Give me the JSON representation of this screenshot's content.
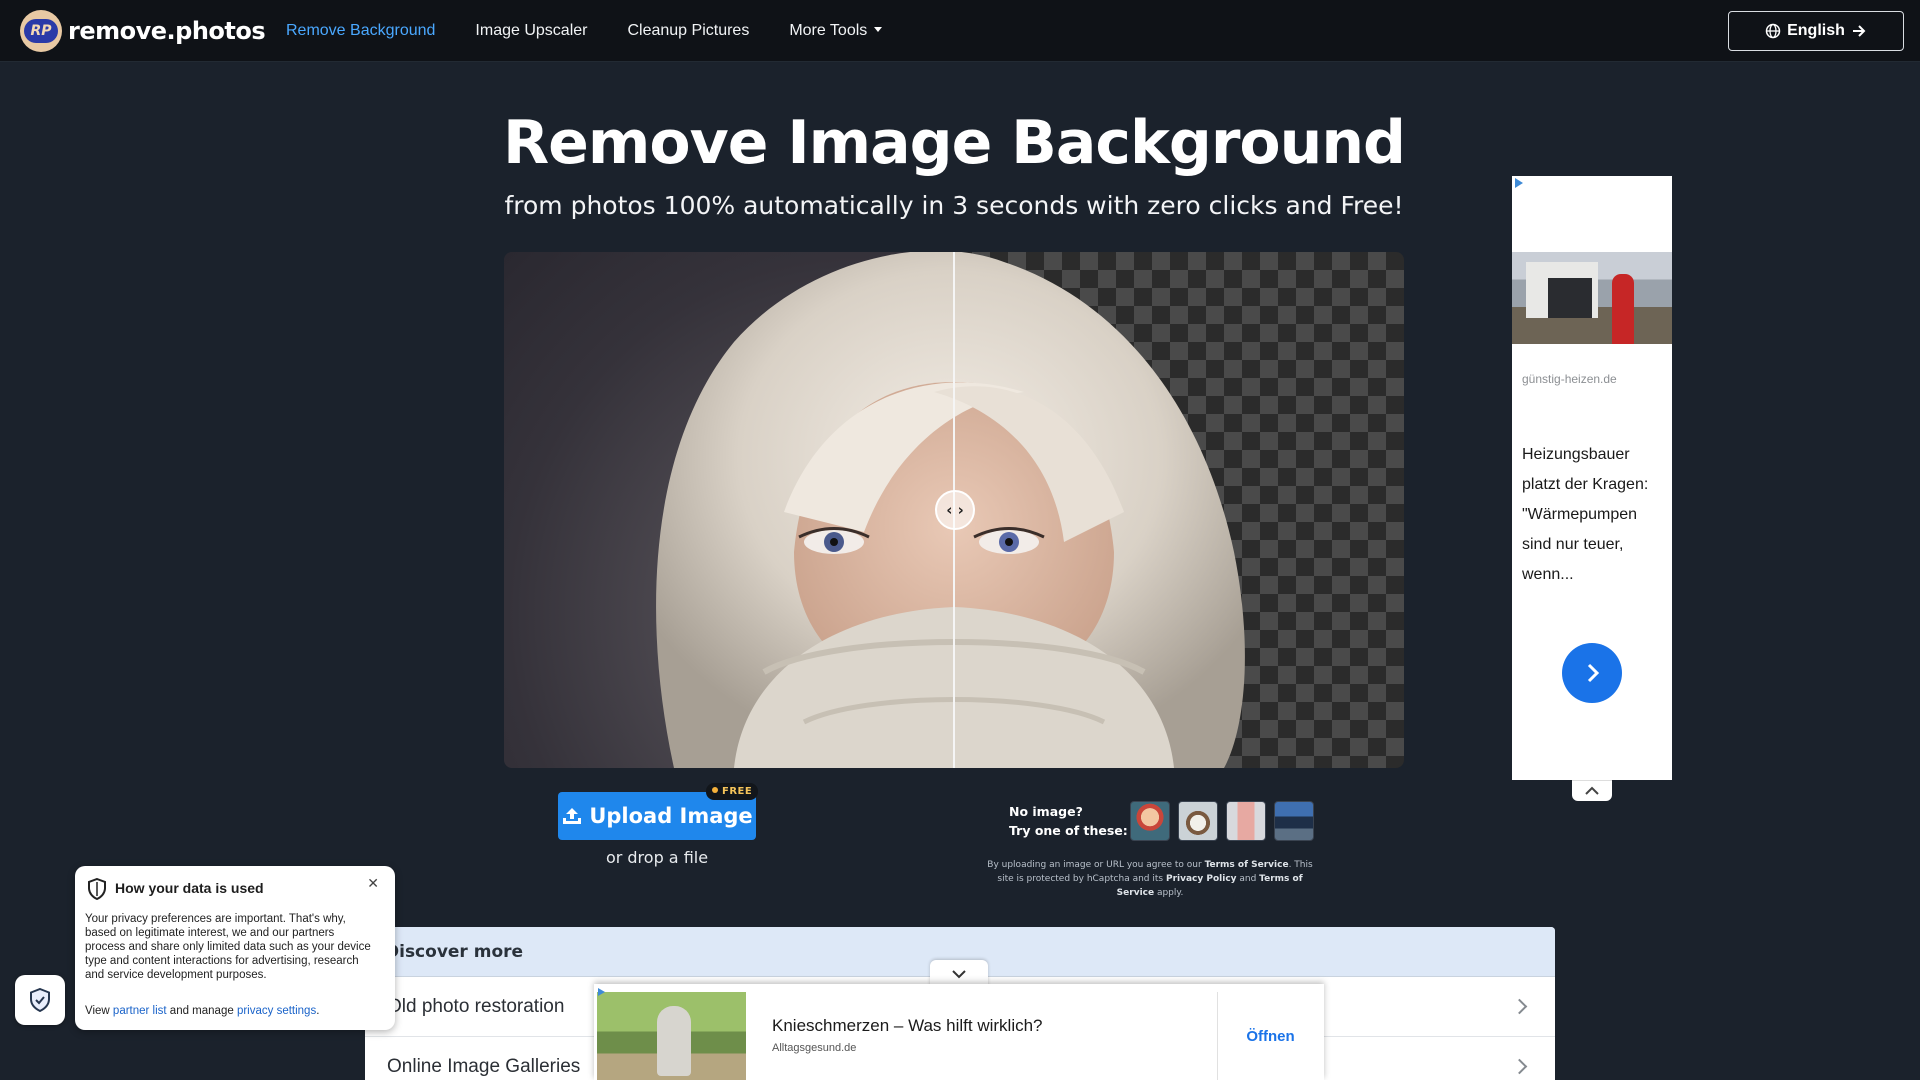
{
  "brand": {
    "logo_mark": "RP",
    "name": "remove.photos"
  },
  "nav": {
    "links": [
      {
        "label": "Remove Background",
        "active": true
      },
      {
        "label": "Image Upscaler",
        "active": false
      },
      {
        "label": "Cleanup Pictures",
        "active": false
      },
      {
        "label": "More Tools",
        "active": false,
        "dropdown": true
      }
    ],
    "language_button": "English"
  },
  "hero": {
    "title": "Remove Image Background",
    "subtitle": "from photos 100% automatically in 3 seconds with zero clicks and Free!"
  },
  "compare": {
    "handle": "‹ ›"
  },
  "upload": {
    "button_label": "Upload Image",
    "badge": "FREE",
    "drop_text": "or drop a file"
  },
  "samples": {
    "line1": "No image?",
    "line2": "Try one of these:",
    "thumbs": [
      "sample-woman",
      "sample-dog",
      "sample-phone",
      "sample-car"
    ]
  },
  "legal": {
    "part1": "By uploading an image or URL you agree to our ",
    "tos": "Terms of Service",
    "part2": ". This site is protected by hCaptcha and its ",
    "privacy": "Privacy Policy",
    "part3": " and ",
    "tos2": "Terms of Service",
    "part4": " apply."
  },
  "discover": {
    "heading": "Discover more",
    "rows": [
      "Old photo restoration",
      "Online Image Galleries"
    ]
  },
  "side_ad": {
    "domain": "günstig-heizen.de",
    "text": "Heizungsbauer platzt der Kragen: \"Wärmepumpen sind nur teuer, wenn..."
  },
  "bottom_ad": {
    "title": "Knieschmerzen – Was hilft wirklich?",
    "domain": "Alltagsgesund.de",
    "cta": "Öffnen"
  },
  "privacy_popup": {
    "title": "How your data is used",
    "close": "✕",
    "body": "Your privacy preferences are important. That's why, based on legitimate interest, we and our partners process and share only limited data such as your device type and content interactions for advertising, research and service development purposes.",
    "foot_prefix": "View ",
    "partner_link": "partner list",
    "foot_middle": " and manage ",
    "settings_link": "privacy settings",
    "foot_suffix": "."
  },
  "colors": {
    "background": "#1b222c",
    "nav_background": "#0f1217",
    "active_link": "#4aa8ff",
    "upload_button": "#1f87ec",
    "ad_accent": "#1a73e8"
  }
}
